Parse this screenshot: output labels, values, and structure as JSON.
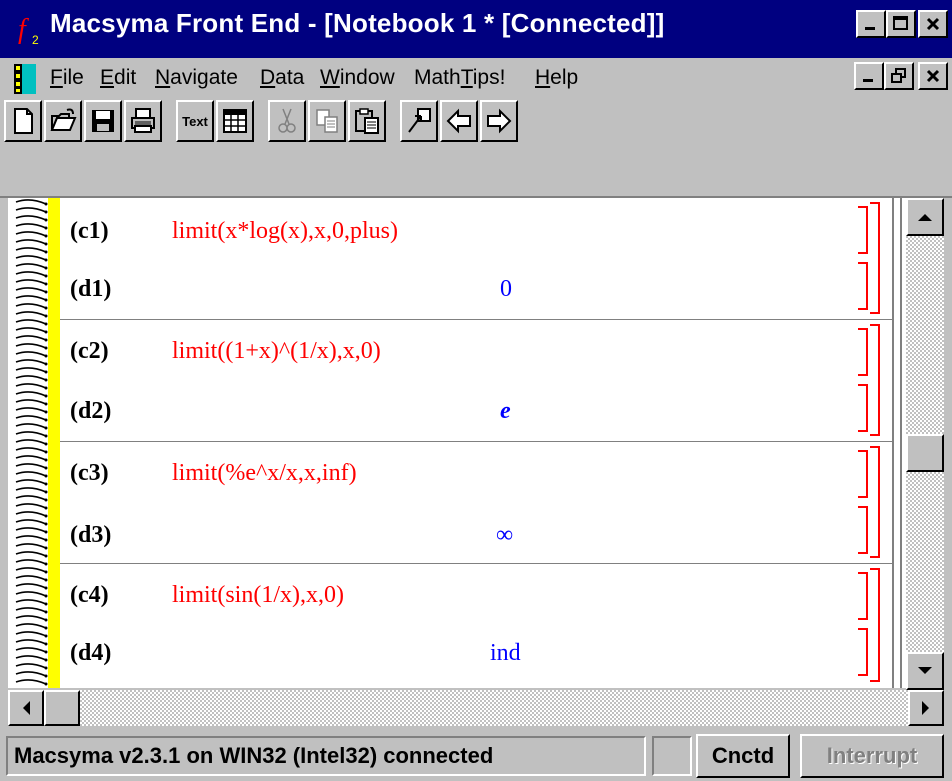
{
  "window": {
    "title": "Macsyma Front End - [Notebook 1 * [Connected]]",
    "controls": {
      "minimize": "_",
      "maximize": "□",
      "close": "×"
    }
  },
  "menu": {
    "items": [
      "File",
      "Edit",
      "Navigate",
      "Data",
      "Window",
      "MathTips!",
      "Help"
    ],
    "mdi_controls": {
      "minimize": "_",
      "restore": "▣",
      "close": "×"
    }
  },
  "toolbar": {
    "buttons": [
      {
        "name": "new-icon"
      },
      {
        "name": "open-icon"
      },
      {
        "name": "save-icon"
      },
      {
        "name": "print-icon"
      },
      {
        "name": "text-button",
        "label": "Text"
      },
      {
        "name": "table-icon"
      },
      {
        "name": "cut-icon"
      },
      {
        "name": "copy-icon"
      },
      {
        "name": "paste-icon"
      },
      {
        "name": "goto-icon"
      },
      {
        "name": "back-arrow-icon"
      },
      {
        "name": "forward-arrow-icon"
      }
    ]
  },
  "cells": [
    {
      "in_label": "(c1)",
      "input": "limit(x*log(x),x,0,plus)",
      "out_label": "(d1)",
      "output": "0"
    },
    {
      "in_label": "(c2)",
      "input": "limit((1+x)^(1/x),x,0)",
      "out_label": "(d2)",
      "output": "e"
    },
    {
      "in_label": "(c3)",
      "input": "limit(%e^x/x,x,inf)",
      "out_label": "(d3)",
      "output": "∞"
    },
    {
      "in_label": "(c4)",
      "input": "limit(sin(1/x),x,0)",
      "out_label": "(d4)",
      "output": "ind"
    }
  ],
  "status": {
    "connection_text": "Macsyma v2.3.1 on WIN32 (Intel32) connected",
    "state_label": "Cnctd",
    "interrupt_label": "Interrupt"
  },
  "colors": {
    "titlebar": "#000080",
    "input_text": "#ff0000",
    "output_text": "#0000ff",
    "spiral_strip": "#ffff00"
  }
}
